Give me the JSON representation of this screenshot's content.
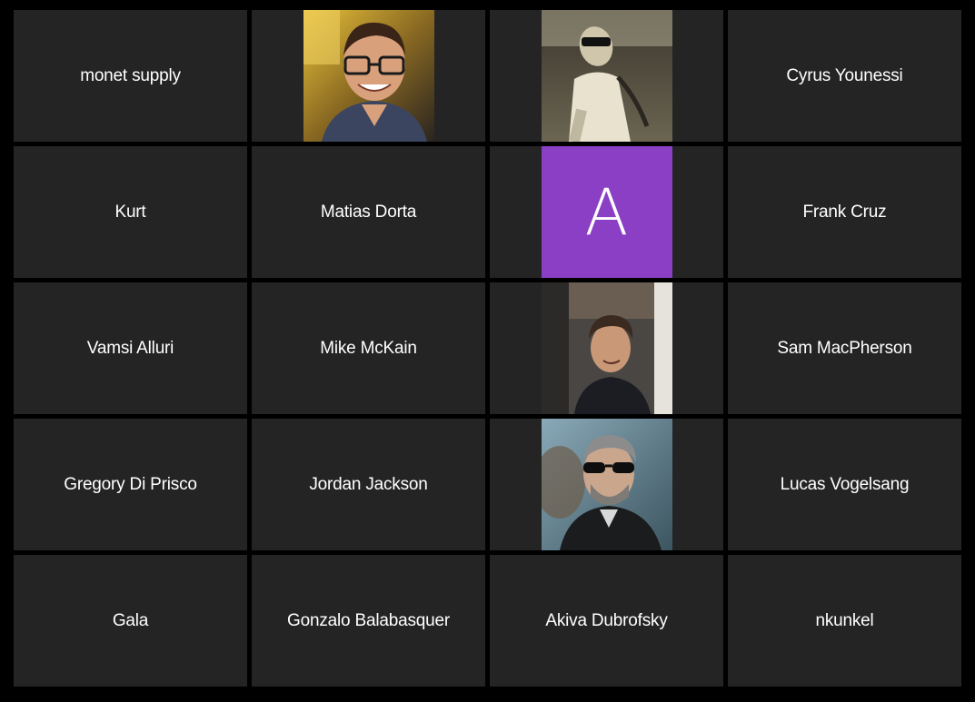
{
  "colors": {
    "background": "#000000",
    "tile": "#242424",
    "text": "#ffffff",
    "avatar_accent": "#8a3fc4"
  },
  "participants": [
    {
      "name": "monet supply",
      "view": "name"
    },
    {
      "name": "",
      "view": "video",
      "icon": "participant-video-icon"
    },
    {
      "name": "",
      "view": "video",
      "icon": "participant-video-icon"
    },
    {
      "name": "Cyrus Younessi",
      "view": "name"
    },
    {
      "name": "Kurt",
      "view": "name"
    },
    {
      "name": "Matias Dorta",
      "view": "name"
    },
    {
      "name": "",
      "view": "avatar",
      "letter": "A"
    },
    {
      "name": "Frank Cruz",
      "view": "name"
    },
    {
      "name": "Vamsi Alluri",
      "view": "name"
    },
    {
      "name": "Mike McKain",
      "view": "name"
    },
    {
      "name": "",
      "view": "video",
      "icon": "participant-video-icon"
    },
    {
      "name": "Sam MacPherson",
      "view": "name"
    },
    {
      "name": "Gregory Di Prisco",
      "view": "name"
    },
    {
      "name": "Jordan Jackson",
      "view": "name"
    },
    {
      "name": "",
      "view": "video",
      "icon": "participant-video-icon"
    },
    {
      "name": "Lucas Vogelsang",
      "view": "name"
    },
    {
      "name": "Gala",
      "view": "name"
    },
    {
      "name": "Gonzalo Balabasquer",
      "view": "name"
    },
    {
      "name": "Akiva Dubrofsky",
      "view": "name"
    },
    {
      "name": "nkunkel",
      "view": "name"
    }
  ]
}
